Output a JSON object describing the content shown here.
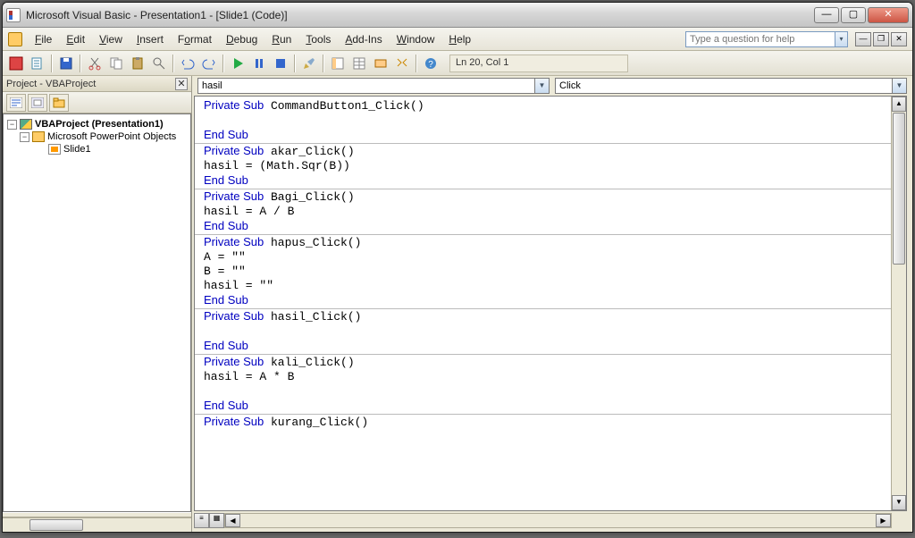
{
  "title": "Microsoft Visual Basic - Presentation1 - [Slide1 (Code)]",
  "menu": [
    "File",
    "Edit",
    "View",
    "Insert",
    "Format",
    "Debug",
    "Run",
    "Tools",
    "Add-Ins",
    "Window",
    "Help"
  ],
  "help_placeholder": "Type a question for help",
  "status": "Ln 20, Col 1",
  "project_panel_title": "Project - VBAProject",
  "tree": {
    "root": "VBAProject (Presentation1)",
    "folder": "Microsoft PowerPoint Objects",
    "slide": "Slide1"
  },
  "dropdown_object": "hasil",
  "dropdown_proc": "Click",
  "code_lines": [
    {
      "t": "line",
      "tokens": [
        [
          "kw",
          "Private Sub"
        ],
        [
          "",
          " CommandButton1_Click()"
        ]
      ]
    },
    {
      "t": "blank"
    },
    {
      "t": "line",
      "tokens": [
        [
          "kw",
          "End Sub"
        ]
      ]
    },
    {
      "t": "hr"
    },
    {
      "t": "line",
      "tokens": [
        [
          "kw",
          "Private Sub"
        ],
        [
          "",
          " akar_Click()"
        ]
      ]
    },
    {
      "t": "line",
      "tokens": [
        [
          "",
          "hasil = (Math.Sqr(B))"
        ]
      ]
    },
    {
      "t": "line",
      "tokens": [
        [
          "kw",
          "End Sub"
        ]
      ]
    },
    {
      "t": "hr"
    },
    {
      "t": "line",
      "tokens": [
        [
          "kw",
          "Private Sub"
        ],
        [
          "",
          " Bagi_Click()"
        ]
      ]
    },
    {
      "t": "line",
      "tokens": [
        [
          "",
          "hasil = A / B"
        ]
      ]
    },
    {
      "t": "line",
      "tokens": [
        [
          "kw",
          "End Sub"
        ]
      ]
    },
    {
      "t": "hr"
    },
    {
      "t": "line",
      "tokens": [
        [
          "kw",
          "Private Sub"
        ],
        [
          "",
          " hapus_Click()"
        ]
      ]
    },
    {
      "t": "line",
      "tokens": [
        [
          "",
          "A = \"\""
        ]
      ]
    },
    {
      "t": "line",
      "tokens": [
        [
          "",
          "B = \"\""
        ]
      ]
    },
    {
      "t": "line",
      "tokens": [
        [
          "",
          "hasil = \"\""
        ]
      ]
    },
    {
      "t": "line",
      "tokens": [
        [
          "kw",
          "End Sub"
        ]
      ]
    },
    {
      "t": "hr"
    },
    {
      "t": "line",
      "tokens": [
        [
          "kw",
          "Private Sub"
        ],
        [
          "",
          " hasil_Click()"
        ]
      ]
    },
    {
      "t": "blank"
    },
    {
      "t": "line",
      "tokens": [
        [
          "kw",
          "End Sub"
        ]
      ]
    },
    {
      "t": "hr"
    },
    {
      "t": "line",
      "tokens": [
        [
          "kw",
          "Private Sub"
        ],
        [
          "",
          " kali_Click()"
        ]
      ]
    },
    {
      "t": "line",
      "tokens": [
        [
          "",
          "hasil = A * B"
        ]
      ]
    },
    {
      "t": "blank"
    },
    {
      "t": "line",
      "tokens": [
        [
          "kw",
          "End Sub"
        ]
      ]
    },
    {
      "t": "hr"
    },
    {
      "t": "line",
      "tokens": [
        [
          "kw",
          "Private Sub"
        ],
        [
          "",
          " kurang_Click()"
        ]
      ]
    }
  ]
}
